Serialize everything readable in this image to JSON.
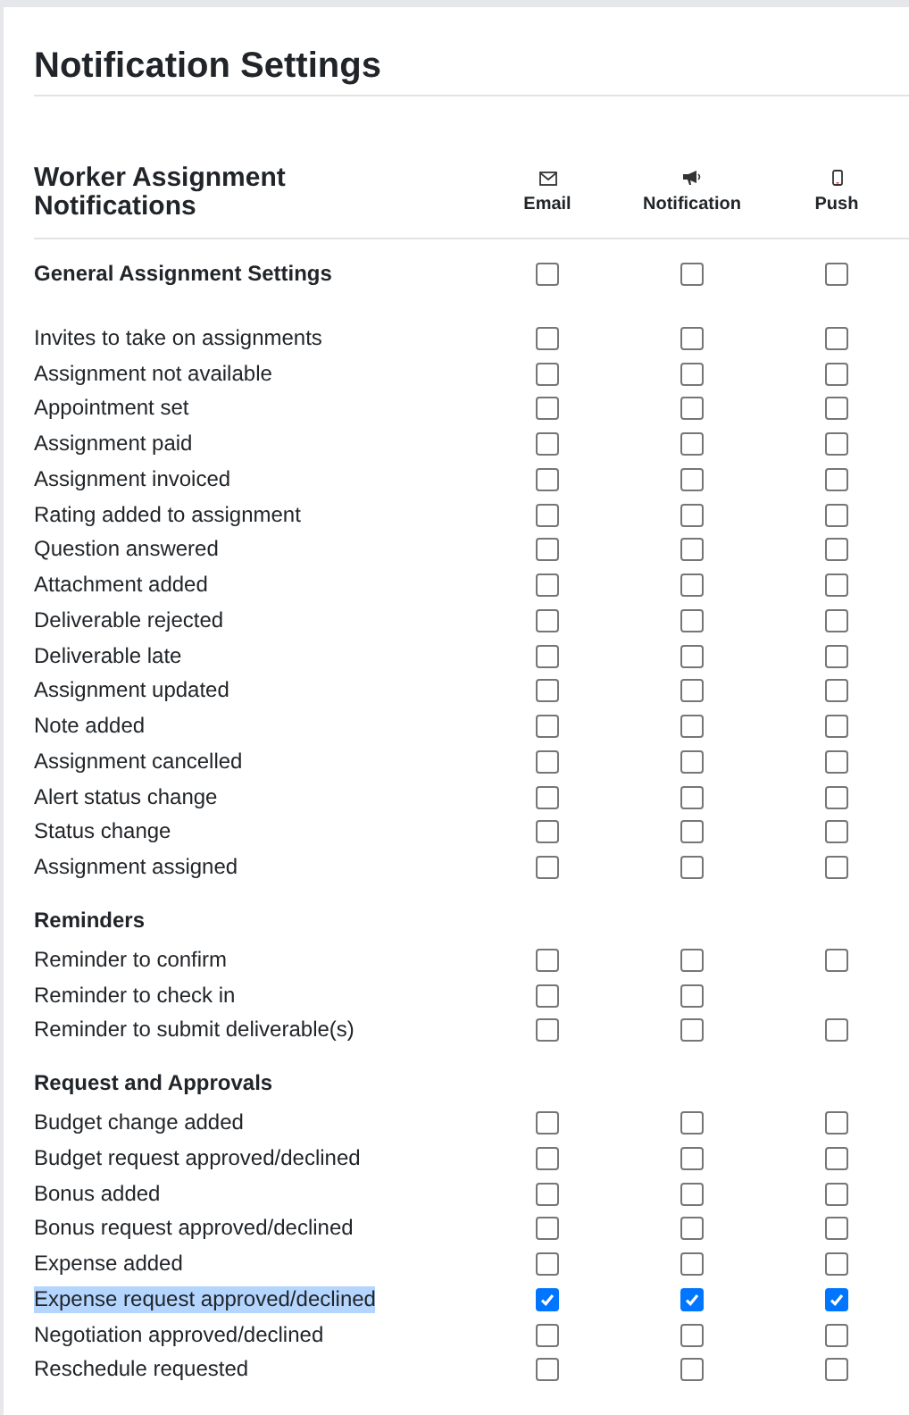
{
  "title": "Notification Settings",
  "group_title": "Worker Assignment Notifications",
  "channels": [
    {
      "kind": "email",
      "label": "Email"
    },
    {
      "kind": "notification",
      "label": "Notification"
    },
    {
      "kind": "push",
      "label": "Push"
    }
  ],
  "sections": [
    {
      "title": "General Assignment Settings",
      "checks": {
        "email": false,
        "notification": false,
        "push": false
      },
      "rows": [
        {
          "label": "Invites to take on assignments",
          "checks": {
            "email": false,
            "notification": false,
            "push": false
          }
        },
        {
          "label": "Assignment not available",
          "checks": {
            "email": false,
            "notification": false,
            "push": false
          }
        },
        {
          "label": "Appointment set",
          "checks": {
            "email": false,
            "notification": false,
            "push": false
          }
        },
        {
          "label": "Assignment paid",
          "checks": {
            "email": false,
            "notification": false,
            "push": false
          }
        },
        {
          "label": "Assignment invoiced",
          "checks": {
            "email": false,
            "notification": false,
            "push": false
          }
        },
        {
          "label": "Rating added to assignment",
          "checks": {
            "email": false,
            "notification": false,
            "push": false
          }
        },
        {
          "label": "Question answered",
          "checks": {
            "email": false,
            "notification": false,
            "push": false
          }
        },
        {
          "label": "Attachment added",
          "checks": {
            "email": false,
            "notification": false,
            "push": false
          }
        },
        {
          "label": "Deliverable rejected",
          "checks": {
            "email": false,
            "notification": false,
            "push": false
          }
        },
        {
          "label": "Deliverable late",
          "checks": {
            "email": false,
            "notification": false,
            "push": false
          }
        },
        {
          "label": "Assignment updated",
          "checks": {
            "email": false,
            "notification": false,
            "push": false
          }
        },
        {
          "label": "Note added",
          "checks": {
            "email": false,
            "notification": false,
            "push": false
          }
        },
        {
          "label": "Assignment cancelled",
          "checks": {
            "email": false,
            "notification": false,
            "push": false
          }
        },
        {
          "label": "Alert status change",
          "checks": {
            "email": false,
            "notification": false,
            "push": false
          }
        },
        {
          "label": "Status change",
          "checks": {
            "email": false,
            "notification": false,
            "push": false
          }
        },
        {
          "label": "Assignment assigned",
          "checks": {
            "email": false,
            "notification": false,
            "push": false
          }
        }
      ]
    },
    {
      "title": "Reminders",
      "rows": [
        {
          "label": "Reminder to confirm",
          "checks": {
            "email": false,
            "notification": false,
            "push": false
          }
        },
        {
          "label": "Reminder to check in",
          "checks": {
            "email": false,
            "notification": false
          }
        },
        {
          "label": "Reminder to submit deliverable(s)",
          "checks": {
            "email": false,
            "notification": false,
            "push": false
          }
        }
      ]
    },
    {
      "title": "Request and Approvals",
      "rows": [
        {
          "label": "Budget change added",
          "checks": {
            "email": false,
            "notification": false,
            "push": false
          }
        },
        {
          "label": "Budget request approved/declined",
          "checks": {
            "email": false,
            "notification": false,
            "push": false
          }
        },
        {
          "label": "Bonus added",
          "checks": {
            "email": false,
            "notification": false,
            "push": false
          }
        },
        {
          "label": "Bonus request approved/declined",
          "checks": {
            "email": false,
            "notification": false,
            "push": false
          }
        },
        {
          "label": "Expense added",
          "checks": {
            "email": false,
            "notification": false,
            "push": false
          }
        },
        {
          "label": "Expense request approved/declined",
          "text_selected": true,
          "checks": {
            "email": true,
            "notification": true,
            "push": true
          }
        },
        {
          "label": "Negotiation approved/declined",
          "checks": {
            "email": false,
            "notification": false,
            "push": false
          }
        },
        {
          "label": "Reschedule requested",
          "checks": {
            "email": false,
            "notification": false,
            "push": false
          }
        }
      ]
    }
  ]
}
